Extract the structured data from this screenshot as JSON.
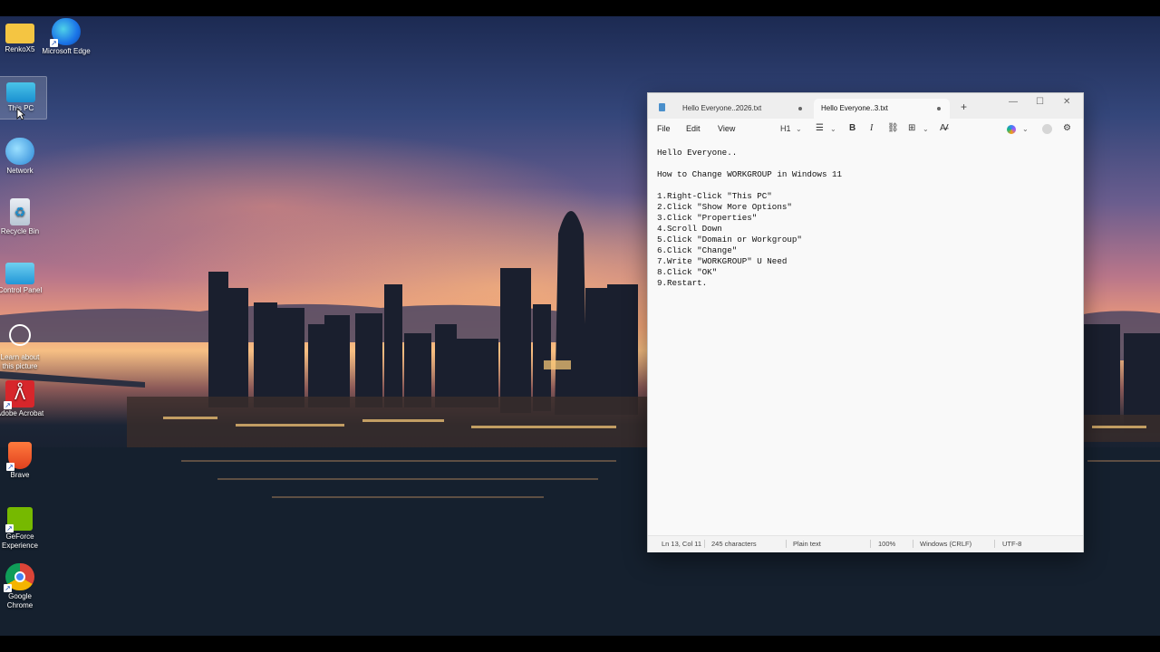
{
  "desktop": {
    "icons": [
      {
        "label": "RenkoX5",
        "icon": "folder-icon"
      },
      {
        "label": "Microsoft Edge",
        "icon": "edge-icon"
      },
      {
        "label": "This PC",
        "icon": "monitor-icon"
      },
      {
        "label": "Network",
        "icon": "network-icon"
      },
      {
        "label": "Recycle Bin",
        "icon": "recycle-bin-icon"
      },
      {
        "label": "Control Panel",
        "icon": "control-panel-icon"
      },
      {
        "label": "Learn about this picture",
        "icon": "camera-icon"
      },
      {
        "label": "Adobe Acrobat",
        "icon": "acrobat-icon"
      },
      {
        "label": "Brave",
        "icon": "brave-icon"
      },
      {
        "label": "GeForce Experience",
        "icon": "nvidia-icon"
      },
      {
        "label": "Google Chrome",
        "icon": "chrome-icon"
      }
    ]
  },
  "notepad": {
    "tabs": [
      {
        "label": "Hello Everyone..2026.txt",
        "active": false
      },
      {
        "label": "Hello Everyone..3.txt",
        "active": true
      }
    ],
    "new_tab": "+",
    "controls": {
      "minimize": "—",
      "maximize": "☐",
      "close": "✕"
    },
    "menu": {
      "file": "File",
      "edit": "Edit",
      "view": "View"
    },
    "toolbar": {
      "heading": "H1",
      "bold": "B",
      "italic": "I"
    },
    "content": [
      "Hello Everyone..",
      "",
      "How to Change WORKGROUP in Windows 11",
      "",
      "1.Right-Click \"This PC\"",
      "2.Click \"Show More Options\"",
      "3.Click \"Properties\"",
      "4.Scroll Down",
      "5.Click \"Domain or Workgroup\"",
      "6.Click \"Change\"",
      "7.Write \"WORKGROUP\" U Need",
      "8.Click \"OK\"",
      "9.Restart."
    ],
    "status": {
      "position": "Ln 13, Col 11",
      "characters": "245 characters",
      "format": "Plain text",
      "zoom": "100%",
      "line_ending": "Windows (CRLF)",
      "encoding": "UTF-8"
    }
  },
  "colors": {
    "accent": "#4a8fcb",
    "window_bg": "#f9f9f9",
    "titlebar_bg": "#eeeeee"
  }
}
